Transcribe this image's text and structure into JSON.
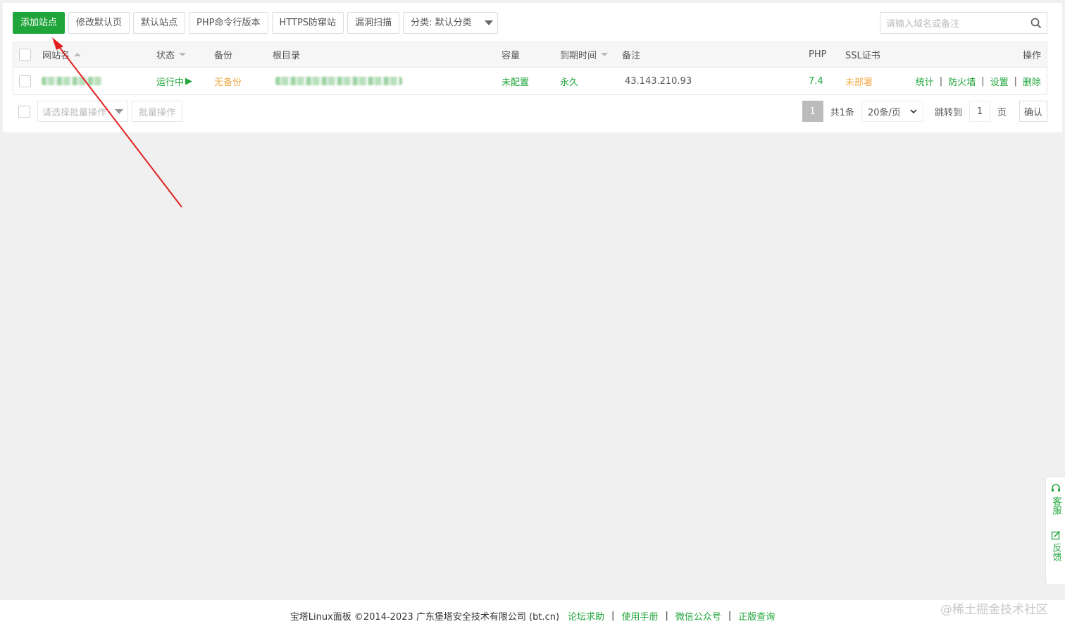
{
  "toolbar": {
    "buttons": [
      "添加站点",
      "修改默认页",
      "默认站点",
      "PHP命令行版本",
      "HTTPS防窜站",
      "漏洞扫描"
    ],
    "category_select": "分类: 默认分类"
  },
  "search": {
    "placeholder": "请输入域名或备注"
  },
  "table": {
    "headers": {
      "site": "网站名",
      "status": "状态",
      "backup": "备份",
      "root": "根目录",
      "capacity": "容量",
      "expire": "到期时间",
      "note": "备注",
      "php": "PHP",
      "ssl": "SSL证书",
      "ops": "操作"
    },
    "rows": [
      {
        "status": "运行中",
        "status_icon": "▶",
        "backup": "无备份",
        "capacity": "未配置",
        "expire": "永久",
        "note": "43.143.210.93",
        "php": "7.4",
        "ssl": "未部署",
        "ops": [
          "统计",
          "防火墙",
          "设置",
          "删除"
        ]
      }
    ]
  },
  "batch": {
    "select_placeholder": "请选择批量操作",
    "button": "批量操作"
  },
  "pager": {
    "current": "1",
    "total": "共1条",
    "per_page": "20条/页",
    "jump_label": "跳转到",
    "jump_value": "1",
    "page_unit": "页",
    "confirm": "确认"
  },
  "side": {
    "service": "客服",
    "feedback": "反馈"
  },
  "footer": {
    "copyright": "宝塔Linux面板 ©2014-2023 广东堡塔安全技术有限公司 (bt.cn)",
    "links": [
      "论坛求助",
      "使用手册",
      "微信公众号",
      "正版查询"
    ]
  },
  "watermark": "@稀土掘金技术社区",
  "colors": {
    "primary": "#20a53a",
    "warning": "#f0ad4e",
    "annotation_arrow": "#e02020"
  }
}
